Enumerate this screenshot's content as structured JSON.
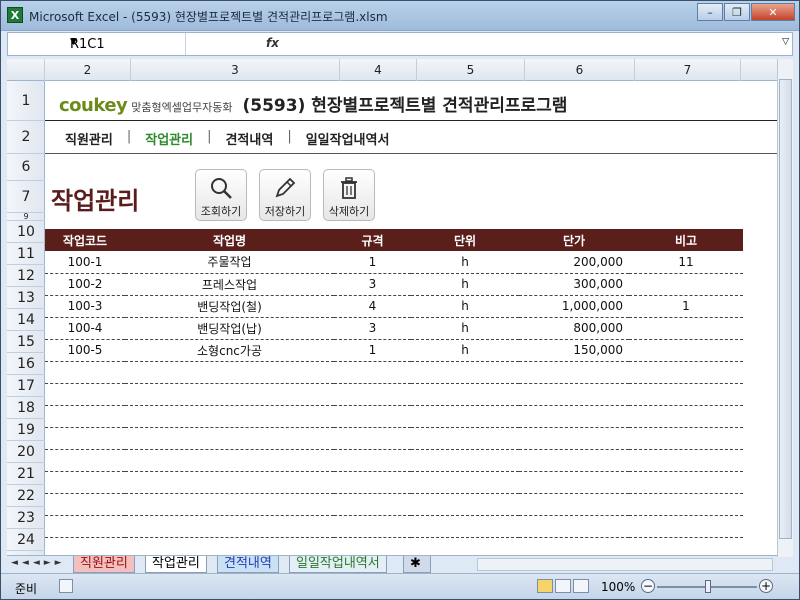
{
  "window": {
    "title": "Microsoft Excel - (5593) 현장별프로젝트별 견적관리프로그램.xlsm",
    "app_icon": "excel-icon"
  },
  "formula_bar": {
    "name_box": "R1C1",
    "fx_label": "fx",
    "formula": ""
  },
  "columns": [
    "2",
    "3",
    "4",
    "5",
    "6",
    "7"
  ],
  "rows": [
    "1",
    "2",
    "6",
    "7",
    "9",
    "10",
    "11",
    "12",
    "13",
    "14",
    "15",
    "16",
    "17",
    "18",
    "19",
    "20",
    "21",
    "22",
    "23",
    "24"
  ],
  "brand": {
    "logo": "coukey",
    "tagline": "맞춤형엑셀업무자동화",
    "program_title": "(5593) 현장별프로젝트별 견적관리프로그램"
  },
  "nav": {
    "items": [
      {
        "label": "직원관리"
      },
      {
        "label": "작업관리"
      },
      {
        "label": "견적내역"
      },
      {
        "label": "일일작업내역서"
      }
    ],
    "separator": "|",
    "active_index": 1
  },
  "section": {
    "title": "작업관리"
  },
  "actions": {
    "search": {
      "label": "조회하기",
      "icon": "magnifier-icon"
    },
    "save": {
      "label": "저장하기",
      "icon": "pencil-icon"
    },
    "delete": {
      "label": "삭제하기",
      "icon": "trash-icon"
    }
  },
  "table": {
    "headers": [
      "작업코드",
      "작업명",
      "규격",
      "단위",
      "단가",
      "비고"
    ],
    "rows": [
      {
        "code": "100-1",
        "name": "주물작업",
        "spec": "1",
        "unit": "h",
        "price": "200,000",
        "note": "11"
      },
      {
        "code": "100-2",
        "name": "프레스작업",
        "spec": "3",
        "unit": "h",
        "price": "300,000",
        "note": ""
      },
      {
        "code": "100-3",
        "name": "밴딩작업(철)",
        "spec": "4",
        "unit": "h",
        "price": "1,000,000",
        "note": "1"
      },
      {
        "code": "100-4",
        "name": "밴딩작업(납)",
        "spec": "3",
        "unit": "h",
        "price": "800,000",
        "note": ""
      },
      {
        "code": "100-5",
        "name": "소형cnc가공",
        "spec": "1",
        "unit": "h",
        "price": "150,000",
        "note": ""
      }
    ],
    "empty_rows": 9
  },
  "sheet_tabs": [
    "직원관리",
    "작업관리",
    "견적내역",
    "일일작업내역서"
  ],
  "status": {
    "mode": "준비",
    "zoom": "100%"
  },
  "colors": {
    "header_bg": "#5b1f1b",
    "active_nav": "#2c8a2c",
    "section_title": "#5a1c1c",
    "logo": "#6e8a1b"
  }
}
